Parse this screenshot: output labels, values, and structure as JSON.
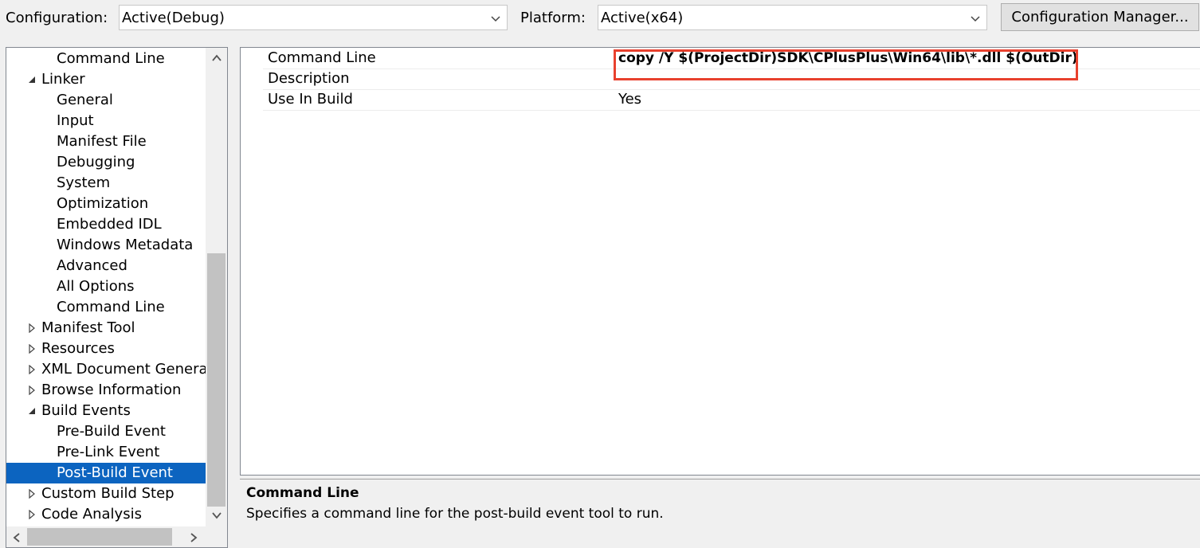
{
  "toolbar": {
    "configuration_label": "Configuration:",
    "configuration_value": "Active(Debug)",
    "platform_label": "Platform:",
    "platform_value": "Active(x64)",
    "configuration_manager_button": "Configuration Manager..."
  },
  "tree": {
    "items": [
      {
        "label": "Command Line",
        "level": 1,
        "expander": "none",
        "selected": false
      },
      {
        "label": "Linker",
        "level": 0,
        "expander": "expanded",
        "selected": false
      },
      {
        "label": "General",
        "level": 1,
        "expander": "none",
        "selected": false
      },
      {
        "label": "Input",
        "level": 1,
        "expander": "none",
        "selected": false
      },
      {
        "label": "Manifest File",
        "level": 1,
        "expander": "none",
        "selected": false
      },
      {
        "label": "Debugging",
        "level": 1,
        "expander": "none",
        "selected": false
      },
      {
        "label": "System",
        "level": 1,
        "expander": "none",
        "selected": false
      },
      {
        "label": "Optimization",
        "level": 1,
        "expander": "none",
        "selected": false
      },
      {
        "label": "Embedded IDL",
        "level": 1,
        "expander": "none",
        "selected": false
      },
      {
        "label": "Windows Metadata",
        "level": 1,
        "expander": "none",
        "selected": false
      },
      {
        "label": "Advanced",
        "level": 1,
        "expander": "none",
        "selected": false
      },
      {
        "label": "All Options",
        "level": 1,
        "expander": "none",
        "selected": false
      },
      {
        "label": "Command Line",
        "level": 1,
        "expander": "none",
        "selected": false
      },
      {
        "label": "Manifest Tool",
        "level": 0,
        "expander": "collapsed",
        "selected": false
      },
      {
        "label": "Resources",
        "level": 0,
        "expander": "collapsed",
        "selected": false
      },
      {
        "label": "XML Document Generat",
        "level": 0,
        "expander": "collapsed",
        "selected": false
      },
      {
        "label": "Browse Information",
        "level": 0,
        "expander": "collapsed",
        "selected": false
      },
      {
        "label": "Build Events",
        "level": 0,
        "expander": "expanded",
        "selected": false
      },
      {
        "label": "Pre-Build Event",
        "level": 1,
        "expander": "none",
        "selected": false
      },
      {
        "label": "Pre-Link Event",
        "level": 1,
        "expander": "none",
        "selected": false
      },
      {
        "label": "Post-Build Event",
        "level": 1,
        "expander": "none",
        "selected": true
      },
      {
        "label": "Custom Build Step",
        "level": 0,
        "expander": "collapsed",
        "selected": false
      },
      {
        "label": "Code Analysis",
        "level": 0,
        "expander": "collapsed",
        "selected": false
      }
    ]
  },
  "grid": {
    "rows": [
      {
        "name": "Command Line",
        "value": "copy /Y $(ProjectDir)SDK\\CPlusPlus\\Win64\\lib\\*.dll  $(OutDir)"
      },
      {
        "name": "Description",
        "value": ""
      },
      {
        "name": "Use In Build",
        "value": "Yes"
      }
    ]
  },
  "description": {
    "title": "Command Line",
    "text": "Specifies a command line for the post-build event tool to run."
  },
  "colors": {
    "selection": "#0c64c0",
    "highlight_box": "#e8412e"
  }
}
